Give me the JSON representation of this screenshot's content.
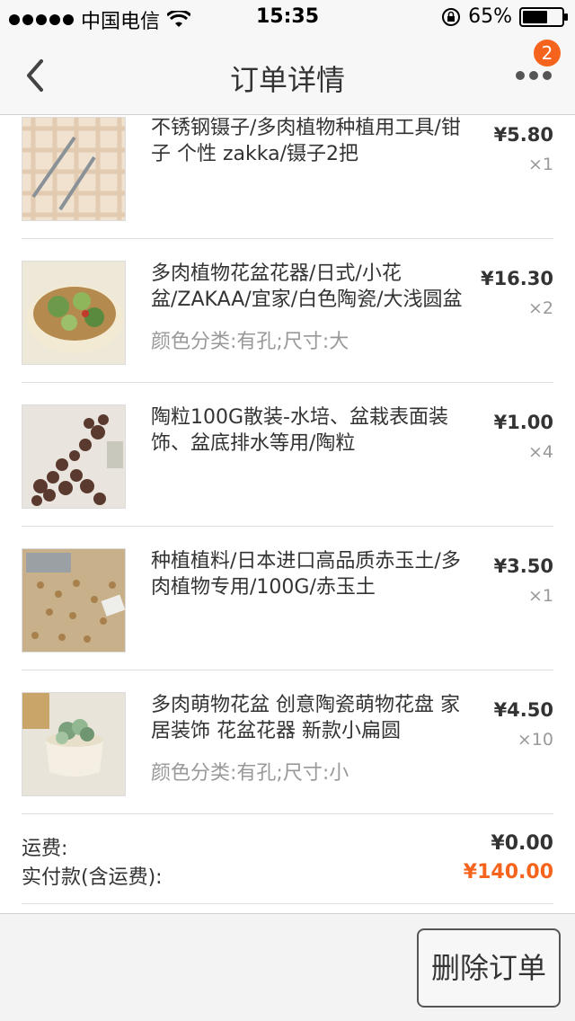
{
  "status_bar": {
    "carrier": "中国电信",
    "time": "15:35",
    "battery": "65%",
    "battery_level": 0.65
  },
  "nav": {
    "title": "订单详情",
    "badge": "2",
    "back_icon": "chevron-left-icon",
    "more_icon": "more-dots-icon"
  },
  "items": [
    {
      "title": "不锈钢镊子/多肉植物种植用工具/钳子 个性 zakka/镊子2把",
      "sku": "",
      "price": "¥5.80",
      "qty": "×1",
      "image": "tweezers-image"
    },
    {
      "title": "多肉植物花盆花器/日式/小花盆/ZAKAA/宜家/白色陶瓷/大浅圆盆",
      "sku": "颜色分类:有孔;尺寸:大",
      "price": "¥16.30",
      "qty": "×2",
      "image": "succulent-bowl-image"
    },
    {
      "title": "陶粒100G散装-水培、盆栽表面装饰、盆底排水等用/陶粒",
      "sku": "",
      "price": "¥1.00",
      "qty": "×4",
      "image": "clay-pebbles-image"
    },
    {
      "title": "种植植料/日本进口高品质赤玉土/多肉植物专用/100G/赤玉土",
      "sku": "",
      "price": "¥3.50",
      "qty": "×1",
      "image": "akadama-soil-image"
    },
    {
      "title": "多肉萌物花盆 创意陶瓷萌物花盘 家居装饰 花盆花器 新款小扁圆",
      "sku": "颜色分类:有孔;尺寸:小",
      "price": "¥4.50",
      "qty": "×10",
      "image": "small-pot-image"
    }
  ],
  "summary": {
    "shipping_label": "运费:",
    "shipping_value": "¥0.00",
    "total_label": "实付款(含运费):",
    "total_value": "¥140.00",
    "accent_color": "#f5631c"
  },
  "footer": {
    "delete_label": "删除订单"
  }
}
